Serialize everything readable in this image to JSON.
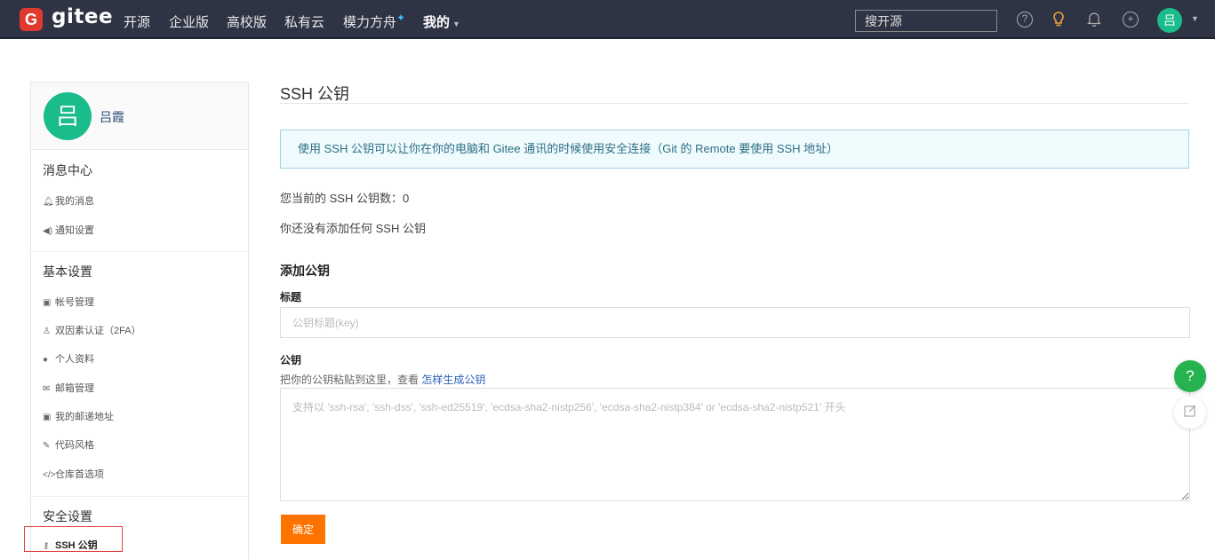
{
  "topnav": {
    "logo_letter": "G",
    "brand": "gitee",
    "items": [
      "开源",
      "企业版",
      "高校版",
      "私有云",
      "模力方舟"
    ],
    "spark": "✦",
    "mine": "我的",
    "search_placeholder": "搜开源",
    "avatar_letter": "吕"
  },
  "sidebar": {
    "avatar_letter": "吕",
    "username": "吕霞",
    "sections": {
      "messages": {
        "title": "消息中心",
        "items": [
          "我的消息",
          "通知设置"
        ]
      },
      "basic": {
        "title": "基本设置",
        "items": [
          "帐号管理",
          "双因素认证（2FA）",
          "个人资料",
          "邮箱管理",
          "我的邮递地址",
          "代码风格",
          "仓库首选项"
        ]
      },
      "security": {
        "title": "安全设置",
        "items": [
          "SSH 公钥"
        ]
      }
    }
  },
  "main": {
    "title": "SSH 公钥",
    "info": "使用 SSH 公钥可以让你在你的电脑和 Gitee 通讯的时候使用安全连接（Git 的 Remote 要使用 SSH 地址）",
    "count_text": "您当前的 SSH 公钥数：0",
    "empty_text": "你还没有添加任何 SSH 公钥",
    "add_heading": "添加公钥",
    "title_label": "标题",
    "title_placeholder": "公钥标题(key)",
    "key_label": "公钥",
    "key_hint": "把你的公钥粘贴到这里，查看",
    "key_hint_link": "怎样生成公钥",
    "key_placeholder": "支持以 'ssh-rsa', 'ssh-dss', 'ssh-ed25519', 'ecdsa-sha2-nistp256', 'ecdsa-sha2-nistp384' or 'ecdsa-sha2-nistp521' 开头",
    "submit": "确定"
  },
  "floating": {
    "help": "?"
  },
  "colors": {
    "nav_bg": "#2f3445",
    "accent_green": "#1abc8c",
    "submit_orange": "#fe7300",
    "info_border": "#9ed6e8",
    "highlight_red": "#e23b3b"
  }
}
